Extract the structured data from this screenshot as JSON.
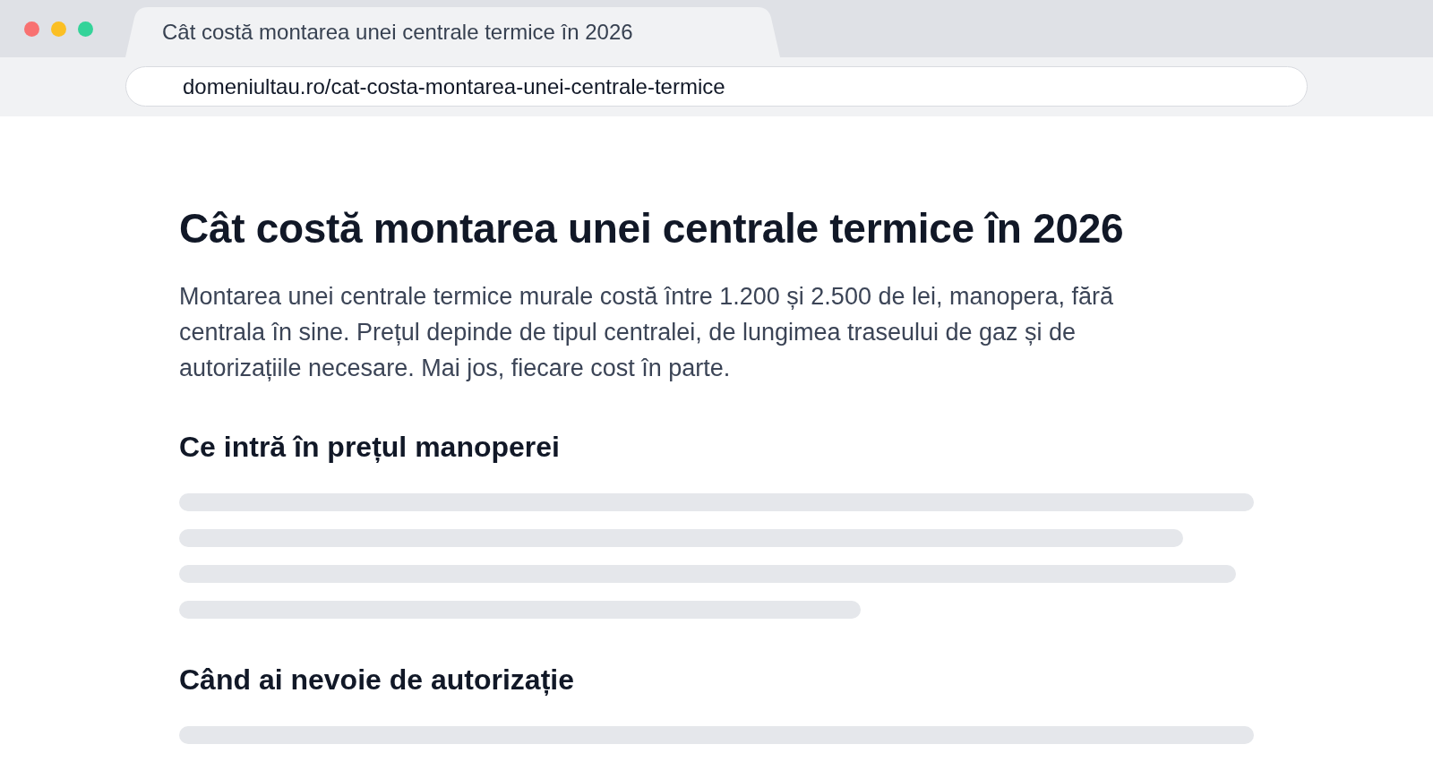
{
  "tabs": [
    {
      "title": "Cât costă montarea unei centrale termice în 2026",
      "selected": true
    }
  ],
  "address_bar": {
    "value": "domeniultau.ro/cat-costa-montarea-unei-centrale-termice"
  },
  "article": {
    "title": "Cât costă montarea unei centrale termice în 2026",
    "intro": "Montarea unei centrale termice murale costă între 1.200 și 2.500 de lei, manopera, fără centrala în sine. Prețul depinde de tipul centralei, de lungimea traseului de gaz și de autorizațiile necesare. Mai jos, fiecare cost în parte.",
    "sections": [
      {
        "heading": "Ce intră în prețul manoperei"
      },
      {
        "heading": "Când ai nevoie de autorizație"
      }
    ]
  }
}
